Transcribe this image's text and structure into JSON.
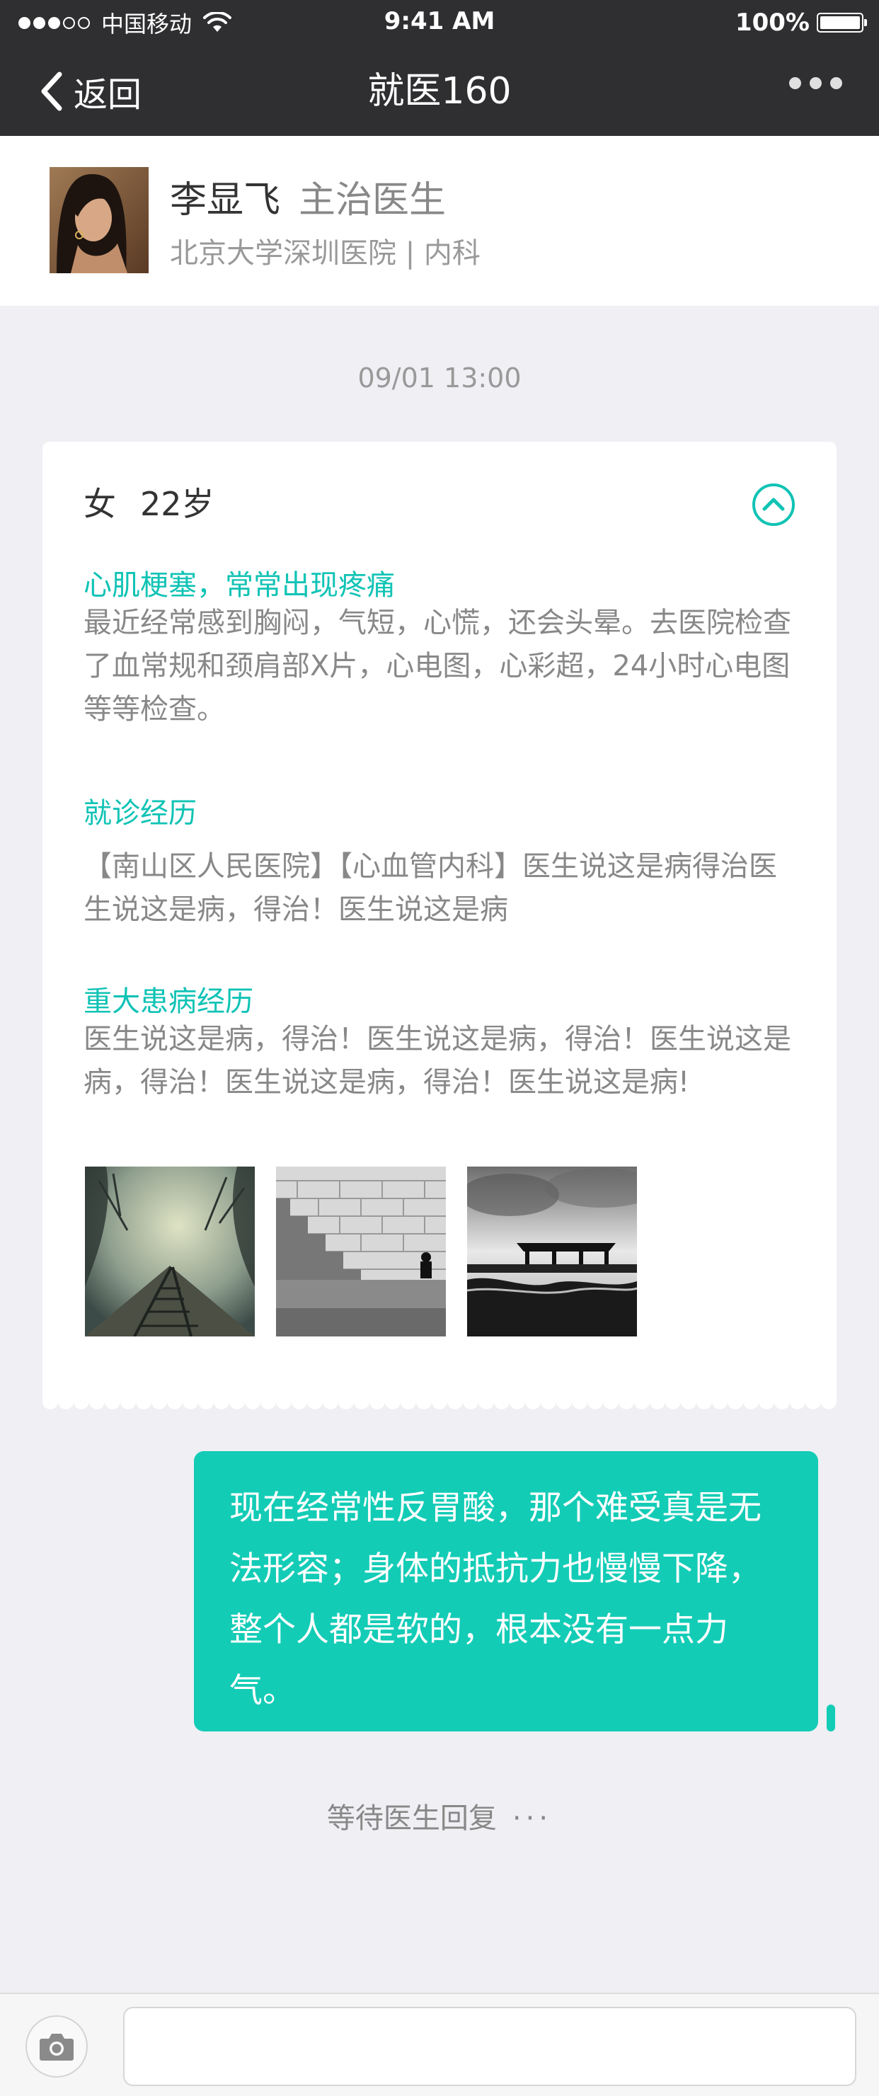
{
  "status_bar": {
    "carrier": "中国移动",
    "time": "9:41 AM",
    "battery": "100%",
    "battery_level": 1.0
  },
  "nav": {
    "back_label": "返回",
    "title": "就医160"
  },
  "doctor": {
    "name": "李显飞",
    "title": "主治医生",
    "hospital": "北京大学深圳医院 | 内科"
  },
  "timestamp": "09/01 13:00",
  "card": {
    "gender": "女",
    "age": "22岁",
    "sections": [
      {
        "title": "心肌梗塞，常常出现疼痛",
        "text": "最近经常感到胸闷，气短，心慌，还会头晕。去医院检查了血常规和颈肩部X片，心电图，心彩超，24小时心电图等等检查。"
      },
      {
        "title": "就诊经历",
        "text": "【南山区人民医院】【心血管内科】医生说这是病得治医生说这是病，得治！医生说这是病"
      },
      {
        "title": "重大患病经历",
        "text": "医生说这是病，得治！医生说这是病，得治！医生说这是病，得治！医生说这是病，得治！医生说这是病!"
      }
    ]
  },
  "message": {
    "text": "现在经常性反胃酸，那个难受真是无法形容；身体的抵抗力也慢慢下降，整个人都是软的，根本没有一点力气。"
  },
  "waiting": {
    "label": "等待医生回复",
    "ellipsis": "···"
  },
  "input_bar": {
    "value": "",
    "placeholder": ""
  },
  "colors": {
    "accent": "#13ccb6",
    "nav_bg": "#2f2f31",
    "page_bg": "#efeff4"
  }
}
